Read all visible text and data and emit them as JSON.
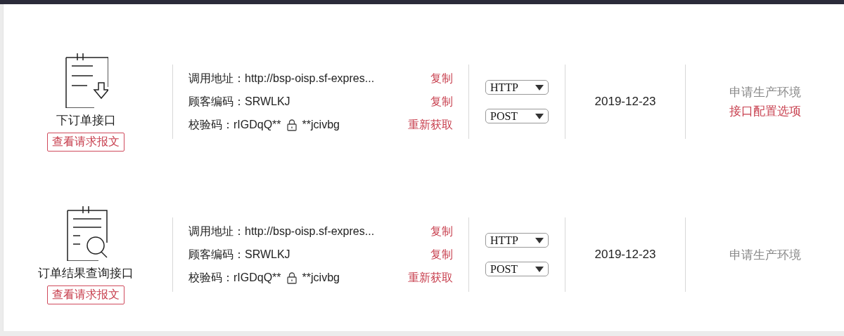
{
  "interfaces": [
    {
      "kind": "download",
      "name": "下订单接口",
      "view_button": "查看请求报文",
      "fields": [
        {
          "kind": "text",
          "label": "调用地址：",
          "value": "http://bsp-oisp.sf-expres...",
          "action": "复制"
        },
        {
          "kind": "text",
          "label": "顾客编码：",
          "value": "SRWLKJ",
          "action": "复制"
        },
        {
          "kind": "secret",
          "label": "校验码：",
          "prefix": "rIGDqQ**",
          "suffix": "**jcivbg",
          "action": "重新获取"
        }
      ],
      "selects": [
        "HTTP",
        "POST"
      ],
      "date": "2019-12-23",
      "links": [
        {
          "kind": "status",
          "text": "申请生产环境"
        },
        {
          "kind": "link",
          "text": "接口配置选项"
        }
      ]
    },
    {
      "kind": "search",
      "name": "订单结果查询接口",
      "view_button": "查看请求报文",
      "fields": [
        {
          "kind": "text",
          "label": "调用地址：",
          "value": "http://bsp-oisp.sf-expres...",
          "action": "复制"
        },
        {
          "kind": "text",
          "label": "顾客编码：",
          "value": "SRWLKJ",
          "action": "复制"
        },
        {
          "kind": "secret",
          "label": "校验码：",
          "prefix": "rIGDqQ**",
          "suffix": "**jcivbg",
          "action": "重新获取"
        }
      ],
      "selects": [
        "HTTP",
        "POST"
      ],
      "date": "2019-12-23",
      "links": [
        {
          "kind": "status",
          "text": "申请生产环境"
        }
      ]
    }
  ]
}
